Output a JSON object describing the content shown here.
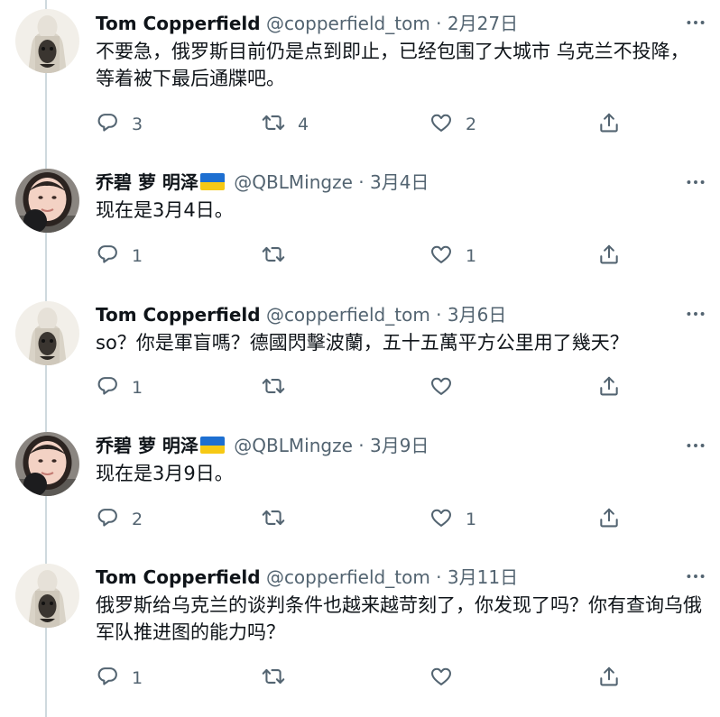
{
  "tweets": [
    {
      "name": "Tom Copperfield",
      "handle": "@copperfield_tom",
      "date": "2月27日",
      "text": "不要急，俄罗斯目前仍是点到即止，已经包围了大城市 乌克兰不投降，等着被下最后通牒吧。",
      "replies": "3",
      "retweets": "4",
      "likes": "2",
      "flag": false
    },
    {
      "name": "乔碧 萝 明泽",
      "handle": "@QBLMingze",
      "date": "3月4日",
      "text": "现在是3月4日。",
      "replies": "1",
      "retweets": "",
      "likes": "1",
      "flag": true
    },
    {
      "name": "Tom Copperfield",
      "handle": "@copperfield_tom",
      "date": "3月6日",
      "text": "so？你是軍盲嗎？德國閃擊波蘭，五十五萬平方公里用了幾天？",
      "replies": "1",
      "retweets": "",
      "likes": "",
      "flag": false
    },
    {
      "name": "乔碧 萝 明泽",
      "handle": "@QBLMingze",
      "date": "3月9日",
      "text": "现在是3月9日。",
      "replies": "2",
      "retweets": "",
      "likes": "1",
      "flag": true
    },
    {
      "name": "Tom Copperfield",
      "handle": "@copperfield_tom",
      "date": "3月11日",
      "text": "俄罗斯给乌克兰的谈判条件也越来越苛刻了，你发现了吗？你有查询乌俄军队推进图的能力吗？",
      "replies": "1",
      "retweets": "",
      "likes": "",
      "flag": false
    }
  ],
  "separator": "·",
  "colors": {
    "secondary_text": "#536471",
    "thread_line": "#cfd9de",
    "flag_blue": "#1d6fd1",
    "flag_yellow": "#f6c915"
  },
  "icons": {
    "reply": "reply-icon",
    "retweet": "retweet-icon",
    "like": "heart-icon",
    "share": "share-icon",
    "more": "more-icon"
  }
}
